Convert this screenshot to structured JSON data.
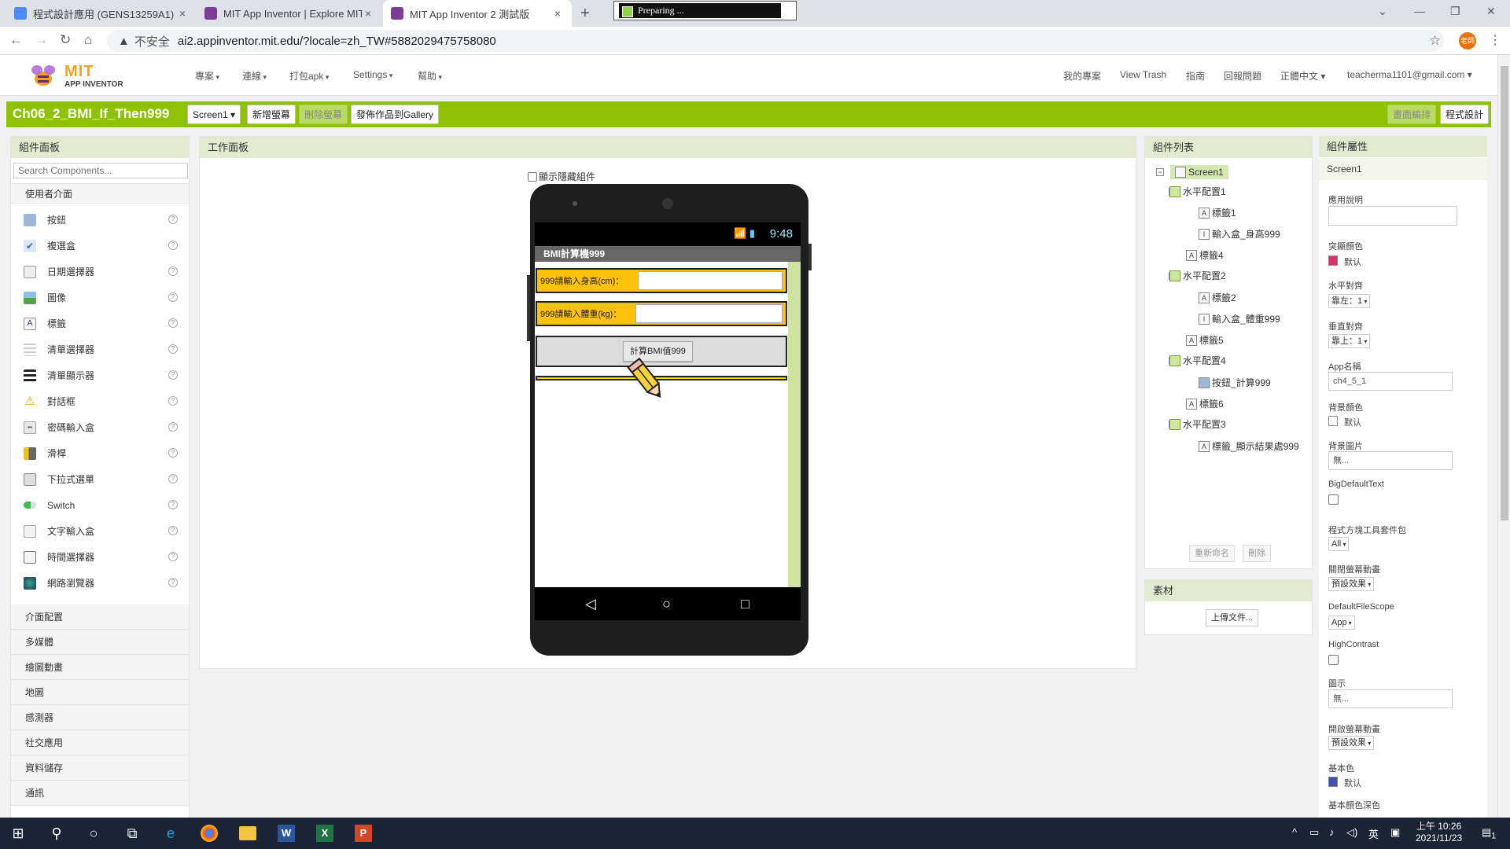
{
  "browser": {
    "tabs": [
      {
        "title": "程式設計應用 (GENS13259A1)",
        "close": "×",
        "favicon_color": "#4c8bf5"
      },
      {
        "title": "MIT App Inventor | Explore MIT",
        "close": "×",
        "favicon_color": "#7d3c98"
      },
      {
        "title": "MIT App Inventor 2 測試版",
        "close": "×",
        "favicon_color": "#7d3c98"
      }
    ],
    "new_tab": "+",
    "preparing_text": "Preparing ...",
    "security_label": "不安全",
    "url": "ai2.appinventor.mit.edu/?locale=zh_TW#5882029475758080",
    "profile_badge": "老師"
  },
  "ai_header": {
    "logo_mit": "MIT",
    "logo_sub": "APP INVENTOR",
    "menus": [
      "專案",
      "連線",
      "打包apk",
      "Settings",
      "幫助"
    ],
    "right_links": [
      "我的專案",
      "View Trash",
      "指南",
      "回報問題"
    ],
    "language": "正體中文",
    "account": "teacherma1101@gmail.com"
  },
  "toolbar": {
    "project_name": "Ch06_2_BMI_If_Then999",
    "screen_select": "Screen1",
    "add_screen": "新增螢幕",
    "remove_screen": "刪除螢幕",
    "publish_gallery": "發佈作品到Gallery",
    "designer": "畫面編排",
    "blocks": "程式設計"
  },
  "palette": {
    "title": "組件面板",
    "search_placeholder": "Search Components...",
    "category_open": "使用者介面",
    "items": [
      {
        "label": "按鈕",
        "help": "?"
      },
      {
        "label": "複選盒",
        "help": "?"
      },
      {
        "label": "日期選擇器",
        "help": "?"
      },
      {
        "label": "圖像",
        "help": "?"
      },
      {
        "label": "標籤",
        "help": "?"
      },
      {
        "label": "清單選擇器",
        "help": "?"
      },
      {
        "label": "清單顯示器",
        "help": "?"
      },
      {
        "label": "對話框",
        "help": "?"
      },
      {
        "label": "密碼輸入盒",
        "help": "?"
      },
      {
        "label": "滑桿",
        "help": "?"
      },
      {
        "label": "下拉式選單",
        "help": "?"
      },
      {
        "label": "Switch",
        "help": "?"
      },
      {
        "label": "文字輸入盒",
        "help": "?"
      },
      {
        "label": "時間選擇器",
        "help": "?"
      },
      {
        "label": "網路瀏覽器",
        "help": "?"
      }
    ],
    "other_categories": [
      "介面配置",
      "多媒體",
      "繪圖動畫",
      "地圖",
      "感測器",
      "社交應用",
      "資料儲存",
      "通訊"
    ]
  },
  "workbench": {
    "title": "工作面板",
    "show_hidden": "顯示隱藏組件",
    "phone": {
      "time": "9:48",
      "app_title": "BMI計算機999",
      "height_label": "999請輸入身高(cm)：",
      "weight_label": "999請輸入體重(kg)：",
      "calc_button": "計算BMI值999"
    }
  },
  "components": {
    "title": "組件列表",
    "tree": {
      "screen": "Screen1",
      "ha1": "水平配置1",
      "label1": "標籤1",
      "tb_height": "輸入盒_身高999",
      "label4": "標籤4",
      "ha2": "水平配置2",
      "label2": "標籤2",
      "tb_weight": "輸入盒_體重999",
      "label5": "標籤5",
      "ha4": "水平配置4",
      "btn_calc": "按鈕_計算999",
      "label6": "標籤6",
      "ha3": "水平配置3",
      "label_result": "標籤_顯示結果處999"
    },
    "rename": "重新命名",
    "delete": "刪除"
  },
  "media": {
    "title": "素材",
    "upload": "上傳文件..."
  },
  "properties": {
    "title": "組件屬性",
    "component": "Screen1",
    "about_label": "應用說明",
    "accent_label": "突顯顏色",
    "accent_value": "默认",
    "accent_color": "#e0306a",
    "align_h_label": "水平對齊",
    "align_h_value": "靠左：1",
    "align_v_label": "垂直對齊",
    "align_v_value": "靠上：1",
    "appname_label": "App名稱",
    "appname_value": "ch4_5_1",
    "bgcolor_label": "背景顏色",
    "bgcolor_value": "默认",
    "bgimage_label": "背景圖片",
    "bgimage_value": "無...",
    "bigtext_label": "BigDefaultText",
    "blocks_toolkit_label": "程式方塊工具套件包",
    "blocks_toolkit_value": "All",
    "close_anim_label": "關閉螢幕動畫",
    "close_anim_value": "預設效果",
    "filescope_label": "DefaultFileScope",
    "filescope_value": "App",
    "highcontrast_label": "HighContrast",
    "icon_label": "圖示",
    "icon_value": "無...",
    "open_anim_label": "開啟螢幕動畫",
    "open_anim_value": "預設效果",
    "primary_label": "基本色",
    "primary_value": "默认",
    "primary_color": "#3f51b5",
    "primary_dark_label": "基本顏色深色"
  },
  "taskbar": {
    "time": "上午 10:26",
    "date": "2021/11/23",
    "ime": "英",
    "notify": "1"
  }
}
